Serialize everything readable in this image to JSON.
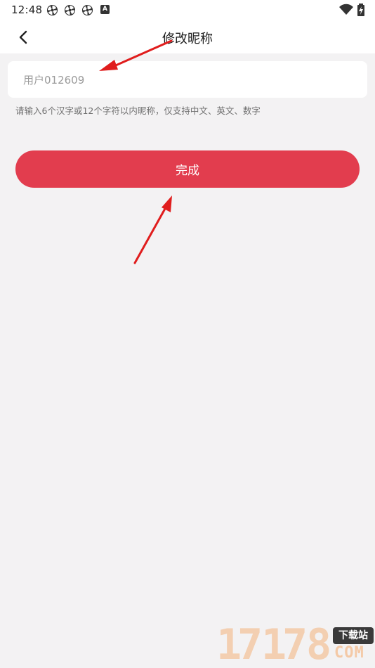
{
  "status_bar": {
    "time": "12:48",
    "notification_icons": [
      "pinwheel-icon",
      "pinwheel-icon",
      "pinwheel-icon",
      "a-badge-icon"
    ],
    "a_badge_text": "A",
    "right_icons": [
      "wifi-icon",
      "battery-charging-icon"
    ]
  },
  "header": {
    "title": "修改昵称",
    "back_icon": "chevron-left-icon"
  },
  "nickname": {
    "value": "用户012609"
  },
  "hint": "请输入6个汉字或12个字符以内昵称，仅支持中文、英文、数字",
  "done_button_label": "完成",
  "colors": {
    "background": "#f3f2f3",
    "accent": "#e23d4e",
    "annotation_arrow": "#e01d1d"
  },
  "watermark": {
    "digits": [
      "1",
      "7",
      "1",
      "7",
      "8"
    ],
    "badge": "下载站",
    "suffix": "COM"
  }
}
